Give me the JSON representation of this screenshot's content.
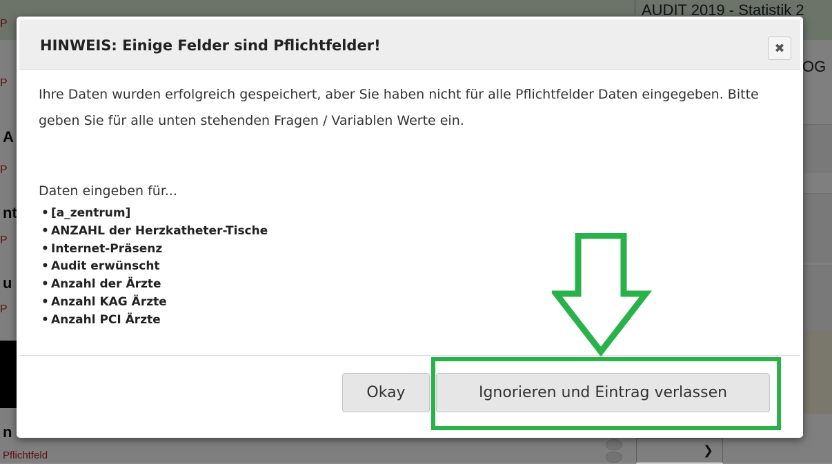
{
  "background": {
    "header_text": "AUDIT 2019 - Statistik 2",
    "side_label": "OG",
    "left_fragments": [
      "P",
      "P",
      "P",
      "P",
      "P"
    ],
    "left_bold_fragments": [
      "A",
      "nt",
      "u",
      "n"
    ],
    "bottom_left_text": "Pflichtfeld"
  },
  "modal": {
    "title": "HINWEIS: Einige Felder sind Pflichtfelder!",
    "close_icon": "close-icon",
    "message": "Ihre Daten wurden erfolgreich gespeichert, aber Sie haben nicht für alle Pflichtfelder Daten eingegeben. Bitte geben Sie für alle unten stehenden Fragen / Variablen Werte ein.",
    "subheading": "Daten eingeben für...",
    "fields": [
      "[a_zentrum]",
      "ANZAHL der Herzkatheter-Tische",
      "Internet-Präsenz",
      "Audit erwünscht",
      "Anzahl der Ärzte",
      "Anzahl KAG Ärzte",
      "Anzahl PCI Ärzte"
    ],
    "buttons": {
      "okay_label": "Okay",
      "ignore_label": "Ignorieren und Eintrag verlassen"
    }
  },
  "annotation": {
    "highlight_color": "#2ab24a",
    "arrow_icon": "down-arrow-icon"
  },
  "colors": {
    "overlay": "rgba(0,0,0,0.5)",
    "header_bg": "#eeeeee",
    "button_bg": "#e6e6e6"
  }
}
